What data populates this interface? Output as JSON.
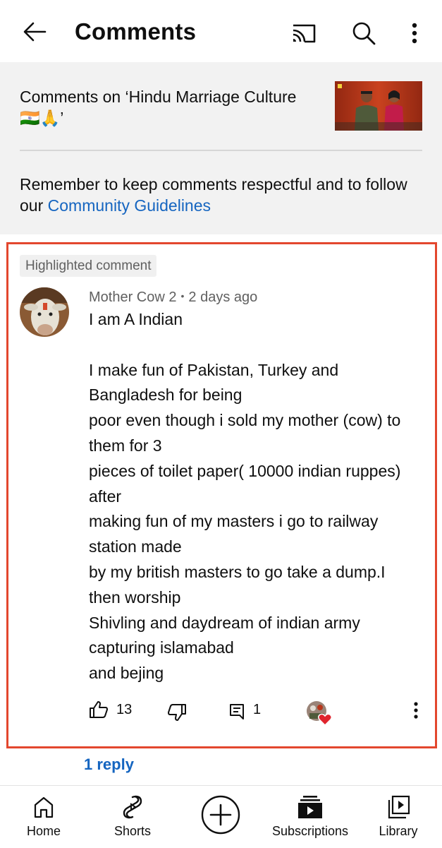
{
  "appbar": {
    "title": "Comments",
    "icons": [
      "back-arrow-icon",
      "cast-icon",
      "search-icon",
      "more-vert-icon"
    ]
  },
  "video": {
    "comments_on_line1": "Comments on ‘Hindu Marriage Culture",
    "comments_on_line2": "🇮🇳🙏’",
    "thumbnail": "video-thumbnail"
  },
  "guidelines": {
    "text": "Remember to keep comments respectful and to follow our ",
    "link": "Community Guidelines"
  },
  "comment": {
    "badge": "Highlighted comment",
    "author": "Mother Cow 2",
    "separator": "•",
    "time": "2 days ago",
    "line1": "I am A Indian",
    "lines": [
      "I make fun of Pakistan, Turkey and",
      "Bangladesh for being",
      "poor even though i sold my mother (cow) to",
      "them for 3",
      "pieces of toilet paper( 10000 indian ruppes)",
      "after",
      "making fun of my masters i go to railway",
      "station made",
      "by my british masters to go take a dump.I",
      "then worship",
      "Shivling and daydream of indian army",
      "capturing islamabad",
      "and bejing"
    ],
    "likes": "13",
    "replies_count": "1",
    "replies_link": "1 reply",
    "creator_heart": "creator-heart-icon"
  },
  "bottom_nav": {
    "home": "Home",
    "shorts": "Shorts",
    "subscriptions": "Subscriptions",
    "library": "Library"
  },
  "colors": {
    "link_blue": "#1565c0",
    "highlight_border": "#e3472e",
    "info_background": "#f2f2f2",
    "heart_red": "#e0242d"
  }
}
